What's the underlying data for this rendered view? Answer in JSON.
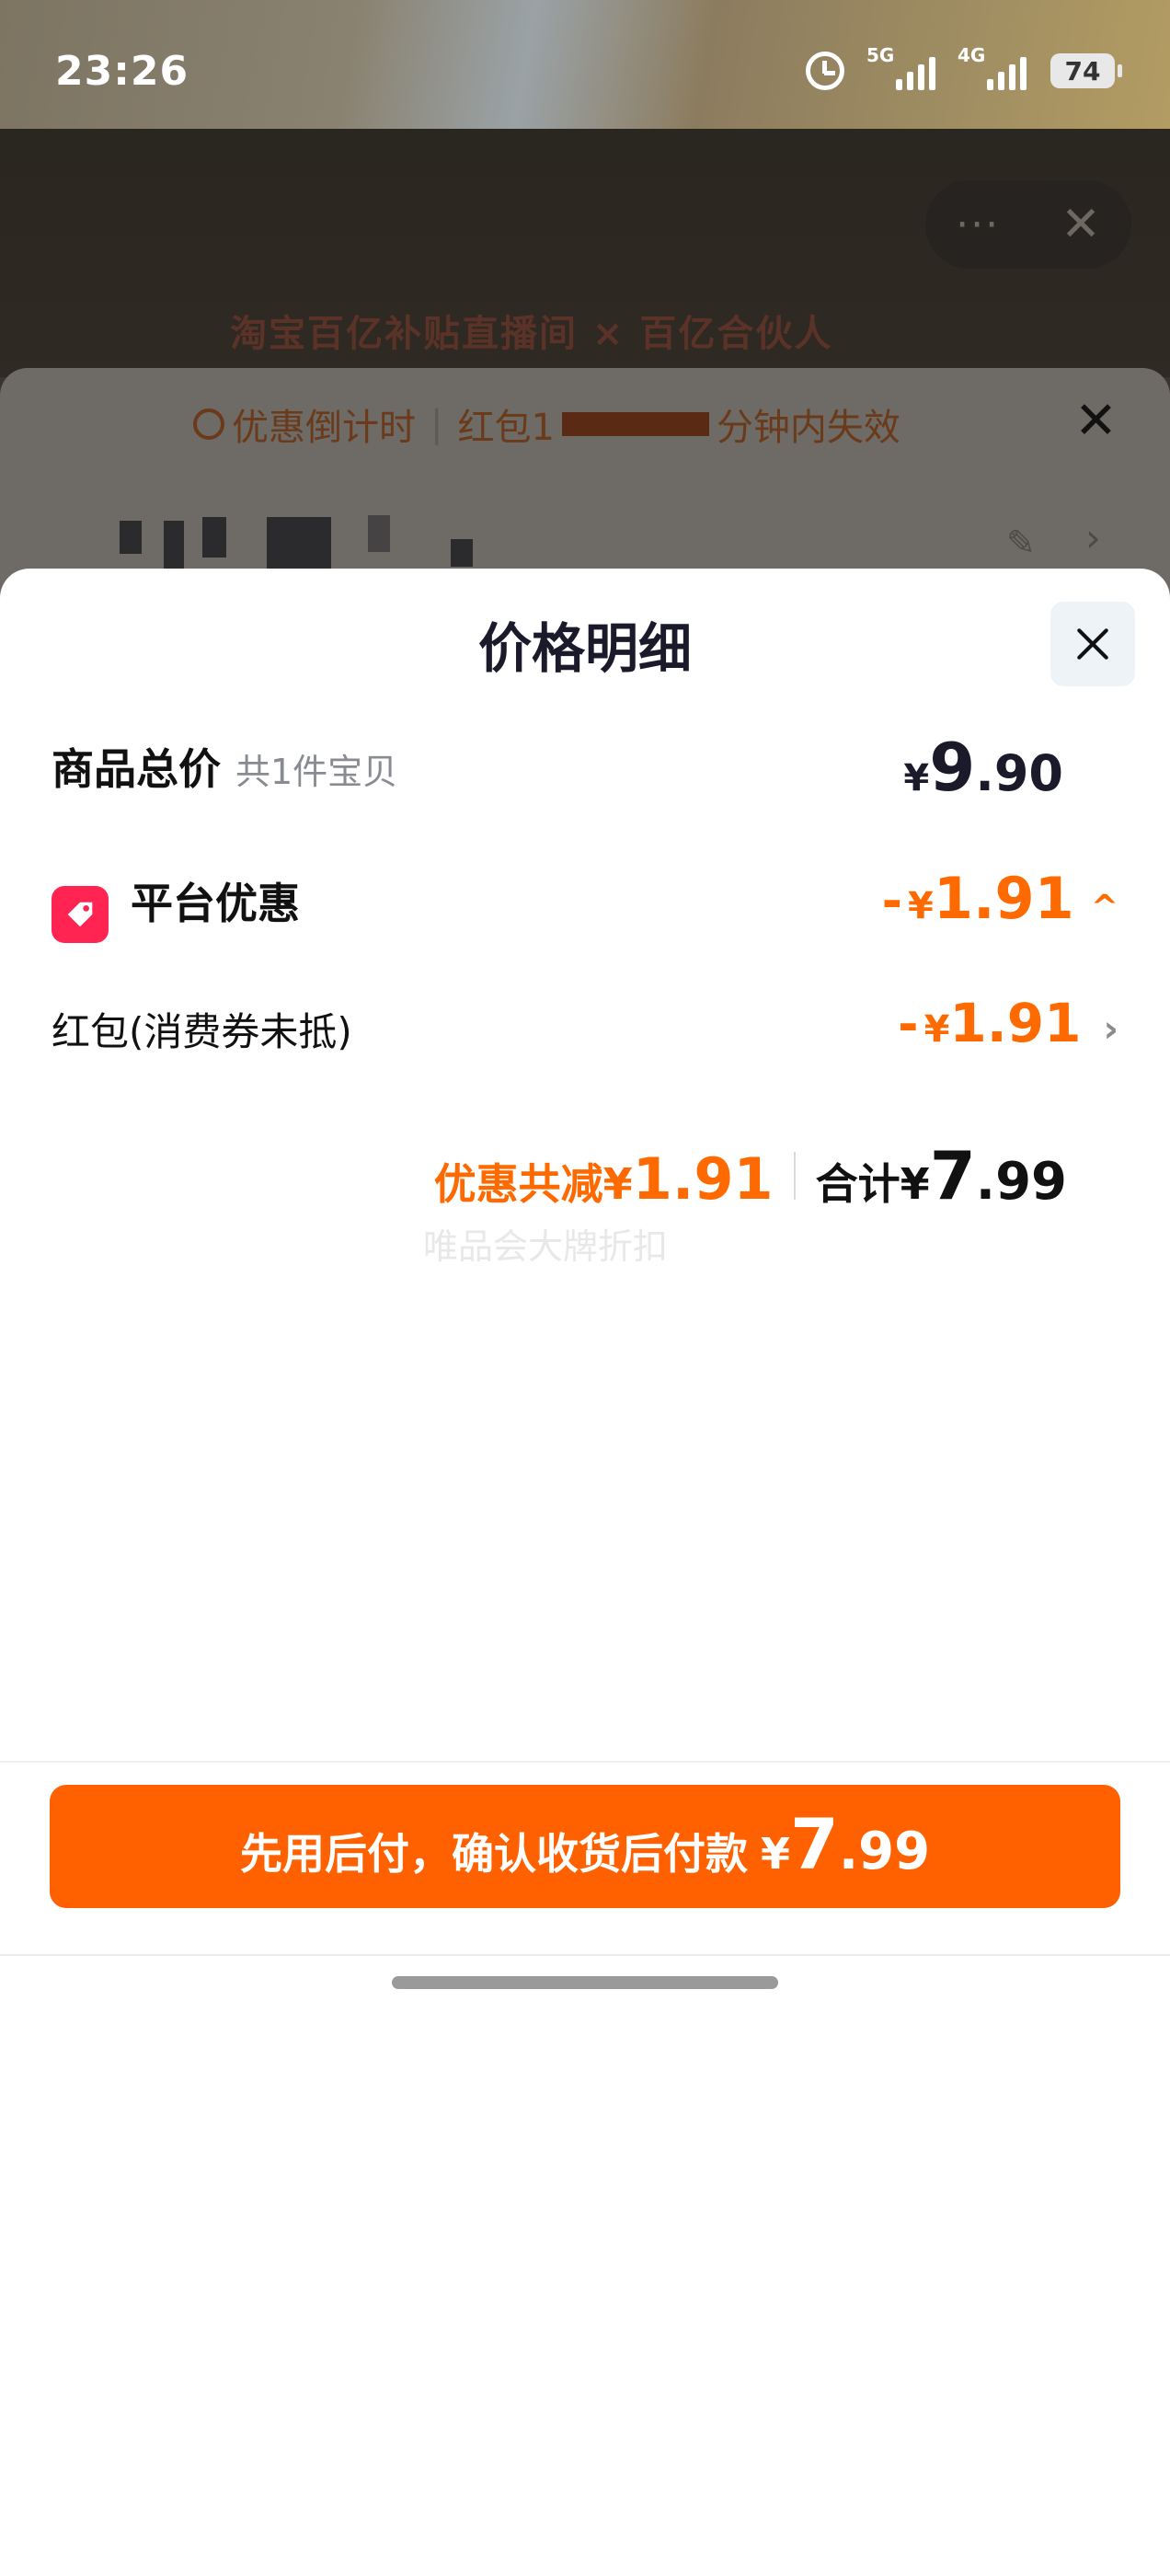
{
  "status_bar": {
    "time": "23:26",
    "signal_1_label": "5G",
    "signal_2_label": "4G",
    "battery": "74"
  },
  "background": {
    "menu_dots": "···",
    "close_glyph": "✕",
    "promo_text": "淘宝百亿补贴直播间 × 百亿合伙人",
    "countdown_label": "优惠倒计时",
    "countdown_text_start": "红包1",
    "countdown_text_end": "分钟内失效",
    "under_close_glyph": "✕"
  },
  "price_sheet": {
    "title": "价格明细",
    "total": {
      "label": "商品总价",
      "sublabel": "共1件宝贝",
      "currency": "¥",
      "int": "9",
      "dec": ".90"
    },
    "platform_discount": {
      "label": "平台优惠",
      "minus": "-",
      "currency": "¥",
      "value": "1.91",
      "caret": "^"
    },
    "red_packet": {
      "label": "红包(消费券未抵)",
      "minus": "-",
      "currency": "¥",
      "value": "1.91",
      "chevron": "›"
    },
    "summary": {
      "save_label": "优惠共减",
      "save_currency": "¥",
      "save_value": "1.91",
      "total_label": "合计",
      "total_currency": "¥",
      "total_int": "7",
      "total_dec": ".99"
    },
    "watermark": "唯品会大牌折扣"
  },
  "pay_button": {
    "label": "先用后付，确认收货后付款",
    "currency": "¥",
    "int": "7",
    "dec": ".99"
  },
  "colors": {
    "accent_orange": "#ff6100",
    "discount_orange": "#ff6a00",
    "tag_red": "#ff2451",
    "text_dark": "#1a1a2a"
  }
}
